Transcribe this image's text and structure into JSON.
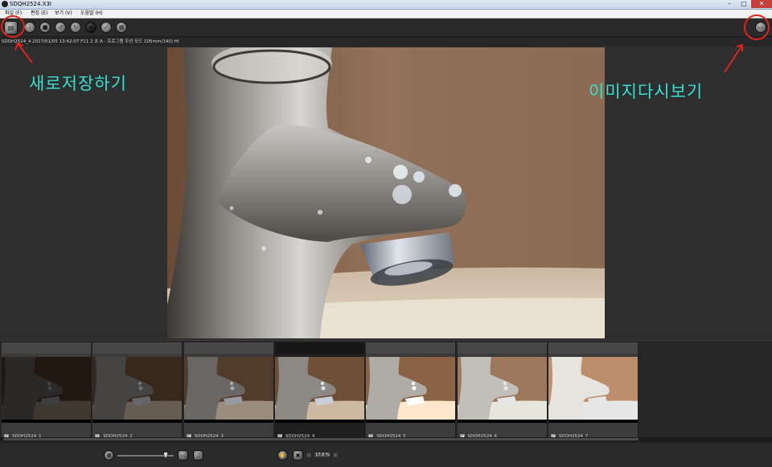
{
  "window": {
    "title": "SDQH2524.X3I"
  },
  "menu": [
    {
      "label": "파일 (F)"
    },
    {
      "label": "편집 (E)"
    },
    {
      "label": "보기 (V)"
    },
    {
      "label": "도움말 (H)"
    }
  ],
  "toolbar": {
    "buttons": [
      {
        "icon": "save-new-icon",
        "glyph": "▤"
      },
      {
        "icon": "info-icon",
        "glyph": "i"
      },
      {
        "icon": "lock-icon",
        "glyph": "■"
      },
      {
        "icon": "rotate-left-icon",
        "glyph": "↺"
      },
      {
        "icon": "rotate-right-icon",
        "glyph": "↻"
      },
      {
        "icon": "black-circle-icon",
        "glyph": "●"
      },
      {
        "icon": "check-icon",
        "glyph": "✓"
      },
      {
        "icon": "grid-icon",
        "glyph": "▦"
      }
    ],
    "right_button": {
      "icon": "single-view-icon",
      "glyph": "▭"
    }
  },
  "file_info": "SDQH2524_4  2017/01/05 13:42:07  F11  2  초  A  -  프로그램 우선 모드  105mm(140)  HI",
  "annotations": {
    "left_label": "새로저장하기",
    "right_label": "이미지다시보기"
  },
  "accent_color": "#36e0d2",
  "annotation_color": "#e0221b",
  "filmstrip": {
    "thumbnails": [
      {
        "name": "SDQH2524_1",
        "checked": true,
        "brightness": 0.3
      },
      {
        "name": "SDQH2524_2",
        "checked": true,
        "brightness": 0.5
      },
      {
        "name": "SDQH2524_3",
        "checked": true,
        "brightness": 0.75
      },
      {
        "name": "SDQH2524_4",
        "checked": true,
        "brightness": 1.0,
        "selected": true
      },
      {
        "name": "SDQH2524_5",
        "checked": true,
        "brightness": 1.25
      },
      {
        "name": "SDQH2524_6",
        "checked": true,
        "brightness": 1.5
      },
      {
        "name": "SDQH2524_7",
        "checked": true,
        "brightness": 1.85
      }
    ]
  },
  "bottom": {
    "zoom_value": "17.6 %",
    "zoom_slider_level": 0.85
  }
}
